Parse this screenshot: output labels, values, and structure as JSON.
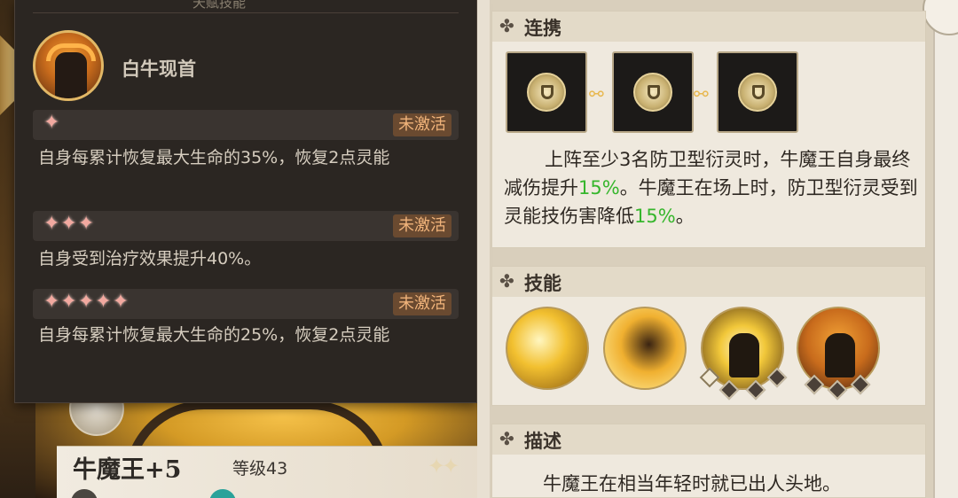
{
  "tooltip": {
    "top_title": "天赋技能",
    "skill_name": "白牛现首",
    "tiers": [
      {
        "stars": "✦",
        "status": "未激活",
        "desc": "自身每累计恢复最大生命的35%，恢复2点灵能"
      },
      {
        "stars": "✦✦✦",
        "status": "未激活",
        "desc": "自身受到治疗效果提升40%。"
      },
      {
        "stars": "✦✦✦✦✦",
        "status": "未激活",
        "desc": "自身每累计恢复最大生命的25%，恢复2点灵能"
      }
    ]
  },
  "hero": {
    "name": "牛魔王+5",
    "level": "等级43",
    "stars": "✦✦"
  },
  "link_panel": {
    "title": "连携",
    "text_a": "上阵至少3名防卫型衍灵时，牛魔王自身最终减伤提升",
    "pct1": "15%",
    "text_b": "。牛魔王在场上时，防卫型衍灵受到灵能技伤害降低",
    "pct2": "15%",
    "text_c": "。"
  },
  "skill_panel": {
    "title": "技能"
  },
  "desc_panel": {
    "title": "描述",
    "text": "牛魔王在相当年轻时就已出人头地。"
  },
  "colors": {
    "highlight": "#36b62c",
    "tooltip_bg": "#2b2622",
    "badge": "#f0b37a"
  },
  "icons": {
    "panel_ornament": "✤",
    "chain": "⚯"
  }
}
